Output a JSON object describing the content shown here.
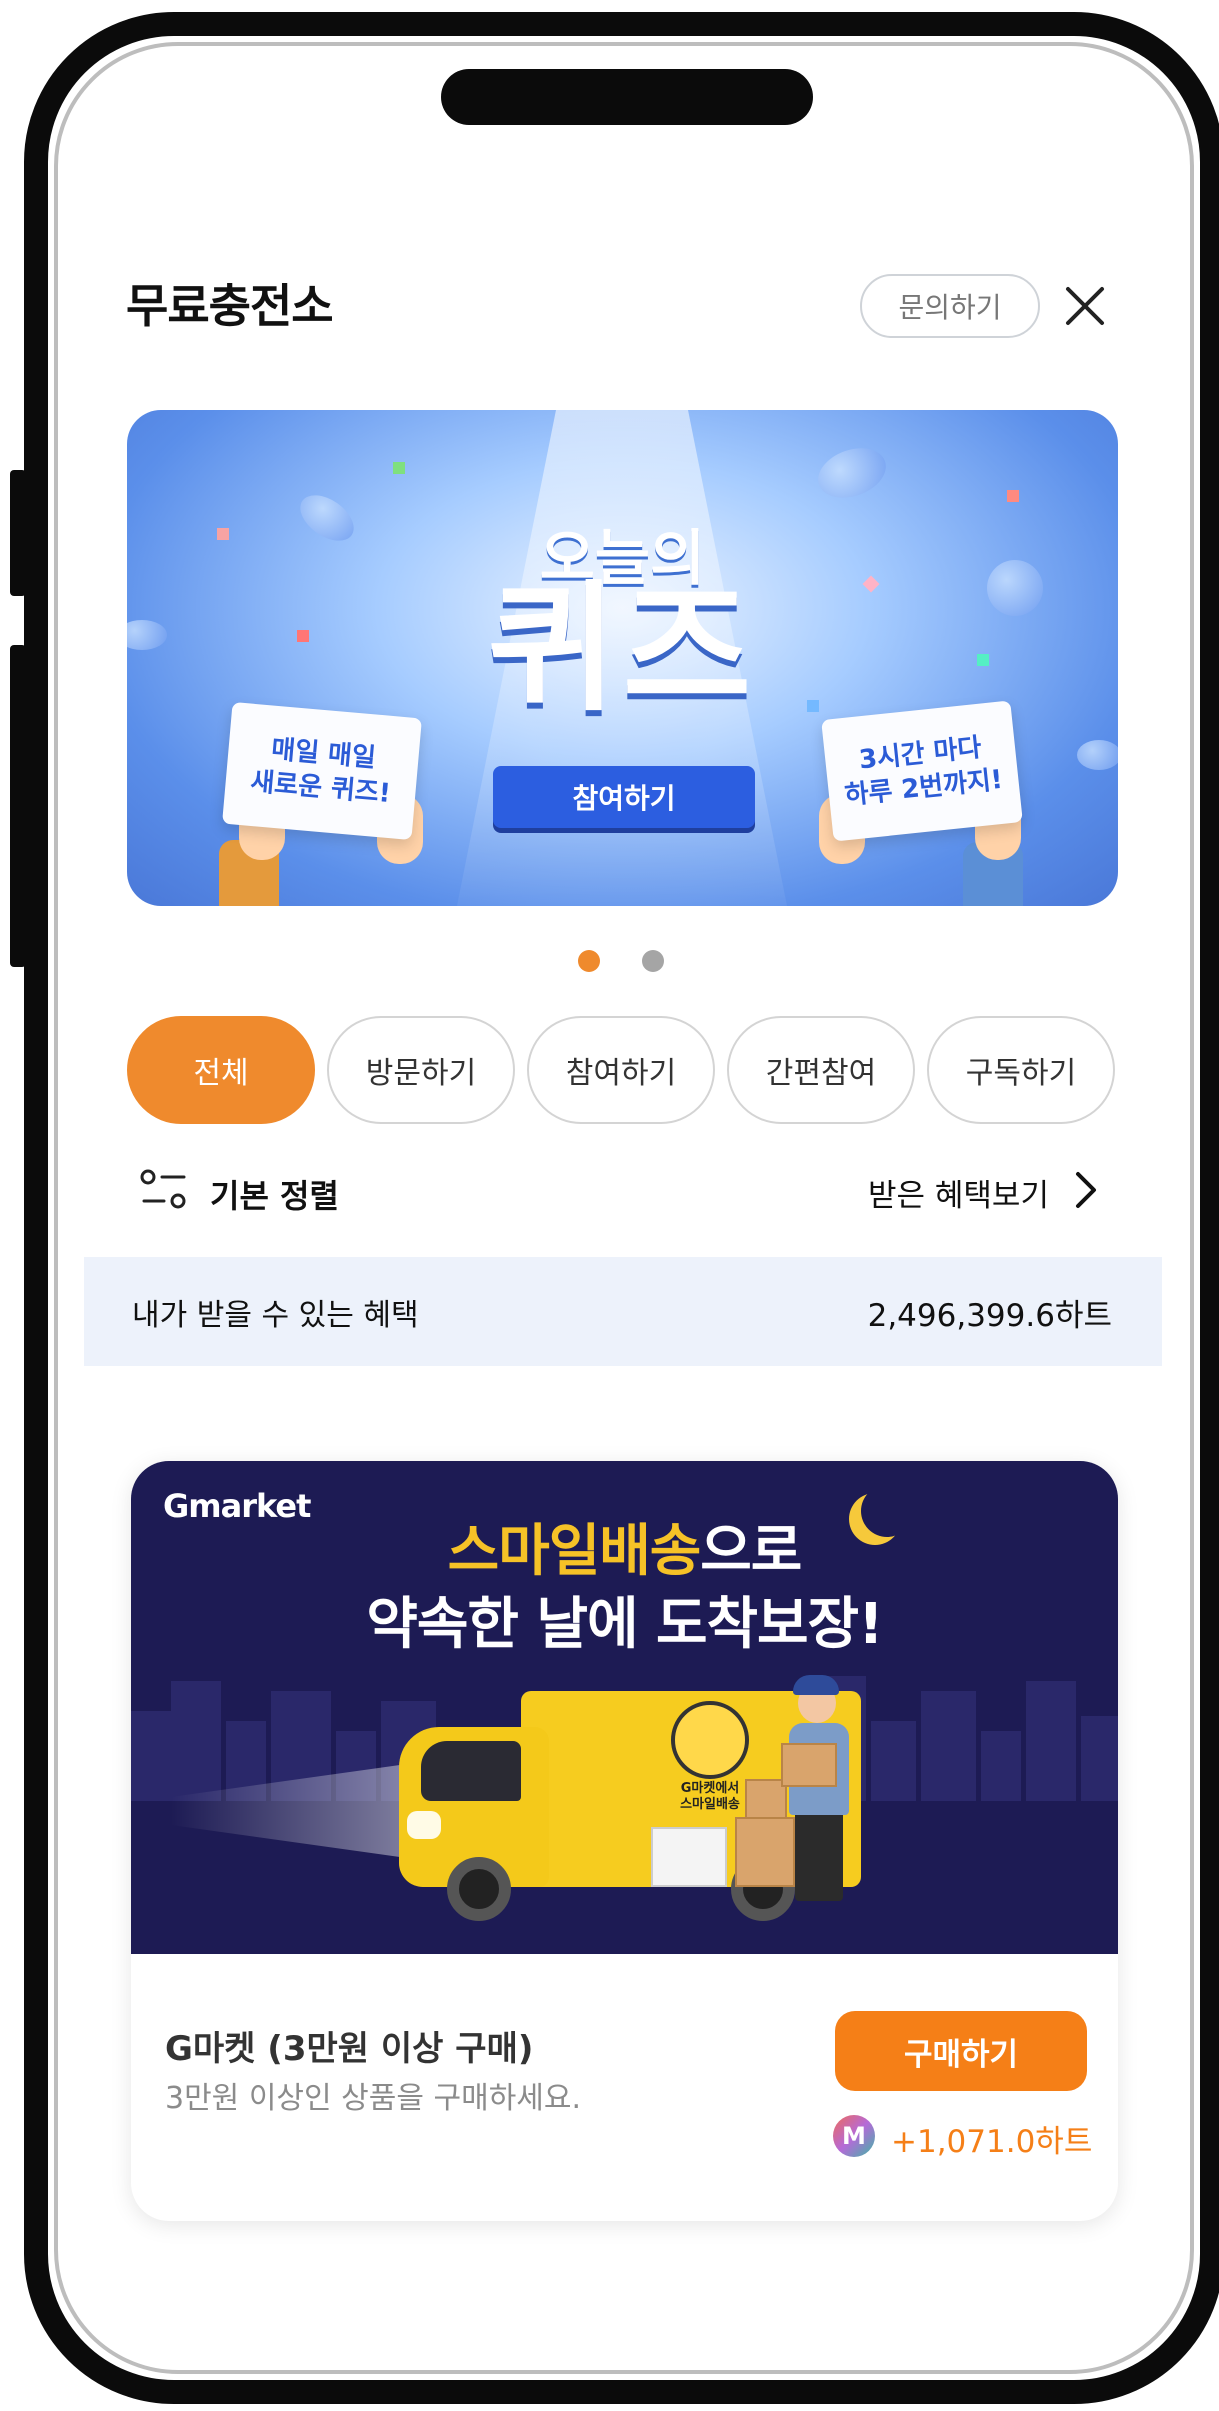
{
  "header": {
    "title": "무료충전소",
    "inquiry_label": "문의하기",
    "close_icon": "close-icon"
  },
  "banner": {
    "subtitle": "오늘의",
    "title": "퀴즈",
    "cta_label": "참여하기",
    "left_sign": "매일 매일\n새로운 퀴즈!",
    "right_sign": "3시간 마다\n하루 2번까지!",
    "page_count": 2,
    "active_page": 1
  },
  "filters": {
    "items": [
      "전체",
      "방문하기",
      "참여하기",
      "간편참여",
      "구독하기"
    ],
    "active": "전체"
  },
  "sort": {
    "icon": "sort-icon",
    "label": "기본 정렬",
    "benefit_link": "받은 혜택보기",
    "chevron_icon": "chevron-right-icon"
  },
  "summary": {
    "label": "내가 받을 수 있는 혜택",
    "value": "2,496,399.6하트"
  },
  "offer": {
    "image": {
      "logo": "Gmarket",
      "headline_highlight": "스마일배송",
      "headline_rest": "으로",
      "headline_line2": "약속한 날에 도착보장!",
      "truck_text": "G마켓에서\n스마일배송"
    },
    "title": "G마켓 (3만원 이상 구매)",
    "description": "3만원 이상인 상품을 구매하세요.",
    "button_label": "구매하기",
    "reward_icon_letter": "M",
    "reward_amount": "+1,071.0하트"
  },
  "colors": {
    "accent_orange": "#ef8a2d",
    "buy_orange": "#f57f17",
    "summary_bg": "#edf2fb",
    "banner_blue": "#5b8fea",
    "card_navy": "#1d1b54"
  }
}
